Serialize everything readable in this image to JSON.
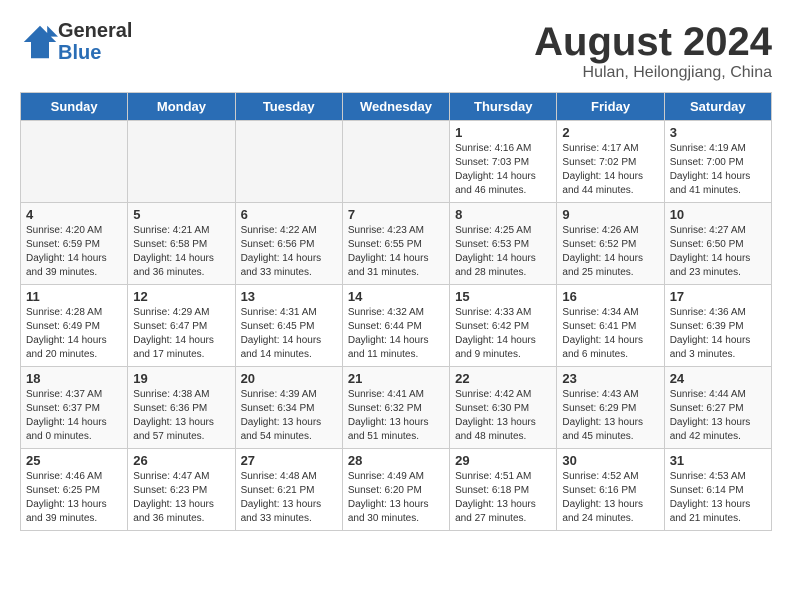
{
  "header": {
    "logo_general": "General",
    "logo_blue": "Blue",
    "month_title": "August 2024",
    "subtitle": "Hulan, Heilongjiang, China"
  },
  "days_of_week": [
    "Sunday",
    "Monday",
    "Tuesday",
    "Wednesday",
    "Thursday",
    "Friday",
    "Saturday"
  ],
  "weeks": [
    [
      {
        "day": "",
        "info": ""
      },
      {
        "day": "",
        "info": ""
      },
      {
        "day": "",
        "info": ""
      },
      {
        "day": "",
        "info": ""
      },
      {
        "day": "1",
        "info": "Sunrise: 4:16 AM\nSunset: 7:03 PM\nDaylight: 14 hours and 46 minutes."
      },
      {
        "day": "2",
        "info": "Sunrise: 4:17 AM\nSunset: 7:02 PM\nDaylight: 14 hours and 44 minutes."
      },
      {
        "day": "3",
        "info": "Sunrise: 4:19 AM\nSunset: 7:00 PM\nDaylight: 14 hours and 41 minutes."
      }
    ],
    [
      {
        "day": "4",
        "info": "Sunrise: 4:20 AM\nSunset: 6:59 PM\nDaylight: 14 hours and 39 minutes."
      },
      {
        "day": "5",
        "info": "Sunrise: 4:21 AM\nSunset: 6:58 PM\nDaylight: 14 hours and 36 minutes."
      },
      {
        "day": "6",
        "info": "Sunrise: 4:22 AM\nSunset: 6:56 PM\nDaylight: 14 hours and 33 minutes."
      },
      {
        "day": "7",
        "info": "Sunrise: 4:23 AM\nSunset: 6:55 PM\nDaylight: 14 hours and 31 minutes."
      },
      {
        "day": "8",
        "info": "Sunrise: 4:25 AM\nSunset: 6:53 PM\nDaylight: 14 hours and 28 minutes."
      },
      {
        "day": "9",
        "info": "Sunrise: 4:26 AM\nSunset: 6:52 PM\nDaylight: 14 hours and 25 minutes."
      },
      {
        "day": "10",
        "info": "Sunrise: 4:27 AM\nSunset: 6:50 PM\nDaylight: 14 hours and 23 minutes."
      }
    ],
    [
      {
        "day": "11",
        "info": "Sunrise: 4:28 AM\nSunset: 6:49 PM\nDaylight: 14 hours and 20 minutes."
      },
      {
        "day": "12",
        "info": "Sunrise: 4:29 AM\nSunset: 6:47 PM\nDaylight: 14 hours and 17 minutes."
      },
      {
        "day": "13",
        "info": "Sunrise: 4:31 AM\nSunset: 6:45 PM\nDaylight: 14 hours and 14 minutes."
      },
      {
        "day": "14",
        "info": "Sunrise: 4:32 AM\nSunset: 6:44 PM\nDaylight: 14 hours and 11 minutes."
      },
      {
        "day": "15",
        "info": "Sunrise: 4:33 AM\nSunset: 6:42 PM\nDaylight: 14 hours and 9 minutes."
      },
      {
        "day": "16",
        "info": "Sunrise: 4:34 AM\nSunset: 6:41 PM\nDaylight: 14 hours and 6 minutes."
      },
      {
        "day": "17",
        "info": "Sunrise: 4:36 AM\nSunset: 6:39 PM\nDaylight: 14 hours and 3 minutes."
      }
    ],
    [
      {
        "day": "18",
        "info": "Sunrise: 4:37 AM\nSunset: 6:37 PM\nDaylight: 14 hours and 0 minutes."
      },
      {
        "day": "19",
        "info": "Sunrise: 4:38 AM\nSunset: 6:36 PM\nDaylight: 13 hours and 57 minutes."
      },
      {
        "day": "20",
        "info": "Sunrise: 4:39 AM\nSunset: 6:34 PM\nDaylight: 13 hours and 54 minutes."
      },
      {
        "day": "21",
        "info": "Sunrise: 4:41 AM\nSunset: 6:32 PM\nDaylight: 13 hours and 51 minutes."
      },
      {
        "day": "22",
        "info": "Sunrise: 4:42 AM\nSunset: 6:30 PM\nDaylight: 13 hours and 48 minutes."
      },
      {
        "day": "23",
        "info": "Sunrise: 4:43 AM\nSunset: 6:29 PM\nDaylight: 13 hours and 45 minutes."
      },
      {
        "day": "24",
        "info": "Sunrise: 4:44 AM\nSunset: 6:27 PM\nDaylight: 13 hours and 42 minutes."
      }
    ],
    [
      {
        "day": "25",
        "info": "Sunrise: 4:46 AM\nSunset: 6:25 PM\nDaylight: 13 hours and 39 minutes."
      },
      {
        "day": "26",
        "info": "Sunrise: 4:47 AM\nSunset: 6:23 PM\nDaylight: 13 hours and 36 minutes."
      },
      {
        "day": "27",
        "info": "Sunrise: 4:48 AM\nSunset: 6:21 PM\nDaylight: 13 hours and 33 minutes."
      },
      {
        "day": "28",
        "info": "Sunrise: 4:49 AM\nSunset: 6:20 PM\nDaylight: 13 hours and 30 minutes."
      },
      {
        "day": "29",
        "info": "Sunrise: 4:51 AM\nSunset: 6:18 PM\nDaylight: 13 hours and 27 minutes."
      },
      {
        "day": "30",
        "info": "Sunrise: 4:52 AM\nSunset: 6:16 PM\nDaylight: 13 hours and 24 minutes."
      },
      {
        "day": "31",
        "info": "Sunrise: 4:53 AM\nSunset: 6:14 PM\nDaylight: 13 hours and 21 minutes."
      }
    ]
  ]
}
